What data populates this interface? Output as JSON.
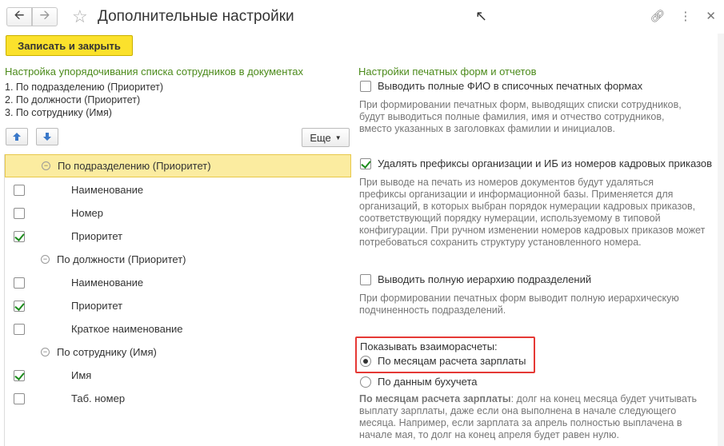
{
  "window": {
    "title": "Дополнительные настройки",
    "back_icon": "arrow-left-icon",
    "forward_icon": "arrow-right-icon",
    "favorite_icon": "star-icon",
    "link_icon": "link-icon",
    "menu_icon": "more-vertical-icon",
    "close_icon": "close-icon"
  },
  "toolbar": {
    "save_close_label": "Записать и закрыть"
  },
  "left": {
    "section_title": "Настройка упорядочивания списка сотрудников в документах",
    "order_lines": [
      "1. По подразделению (Приоритет)",
      "2. По должности (Приоритет)",
      "3. По сотруднику (Имя)"
    ],
    "more_label": "Еще",
    "tree": [
      {
        "type": "group",
        "label": "По подразделению (Приоритет)",
        "selected": true
      },
      {
        "type": "item",
        "label": "Наименование",
        "checked": false
      },
      {
        "type": "item",
        "label": "Номер",
        "checked": false
      },
      {
        "type": "item",
        "label": "Приоритет",
        "checked": true
      },
      {
        "type": "group",
        "label": "По должности (Приоритет)",
        "selected": false
      },
      {
        "type": "item",
        "label": "Наименование",
        "checked": false
      },
      {
        "type": "item",
        "label": "Приоритет",
        "checked": true
      },
      {
        "type": "item",
        "label": "Краткое наименование",
        "checked": false
      },
      {
        "type": "group",
        "label": "По сотруднику (Имя)",
        "selected": false
      },
      {
        "type": "item",
        "label": "Имя",
        "checked": true
      },
      {
        "type": "item",
        "label": "Таб. номер",
        "checked": false
      }
    ]
  },
  "right": {
    "section_title": "Настройки печатных форм и отчетов",
    "option1": {
      "label": "Выводить полные ФИО в списочных печатных формах",
      "checked": false,
      "desc": [
        "При формировании печатных форм, выводящих списки сотрудников,",
        "будут выводиться полные фамилия, имя и отчество сотрудников,",
        "вместо указанных в заголовках фамилии и инициалов."
      ]
    },
    "option2": {
      "label": "Удалять префиксы организации и ИБ из номеров кадровых приказов",
      "checked": true,
      "desc": [
        "При выводе на печать из номеров документов будут удаляться",
        "префиксы организации и информационной базы. Применяется для",
        "организаций, в которых выбран порядок нумерации кадровых приказов,",
        "соответствующий порядку нумерации, используемому в типовой",
        "конфигурации. При ручном изменении номеров кадровых приказов может",
        "потребоваться сохранить структуру установленного номера."
      ]
    },
    "option3": {
      "label": "Выводить полную иерархию подразделений",
      "checked": false,
      "desc": [
        "При формировании печатных форм выводит полную иерархическую",
        "подчиненность подразделений."
      ]
    },
    "settlements": {
      "title": "Показывать взаиморасчеты:",
      "option_months": "По месяцам расчета зарплаты",
      "option_accounting": "По данным бухучета",
      "selected": "По месяцам расчета зарплаты",
      "desc_bold": "По месяцам расчета зарплаты",
      "desc_rest": ": долг на конец месяца будет учитывать",
      "desc_lines": [
        "выплату зарплаты, даже если она выполнена в начале следующего",
        "месяца. Например, если зарплата за апрель полностью выплачена в",
        "начале мая, то долг на конец апреля будет равен нулю."
      ]
    }
  },
  "colors": {
    "accent_yellow": "#fbe12c",
    "section_green": "#4b8a1a",
    "highlight_red": "#e53935"
  }
}
